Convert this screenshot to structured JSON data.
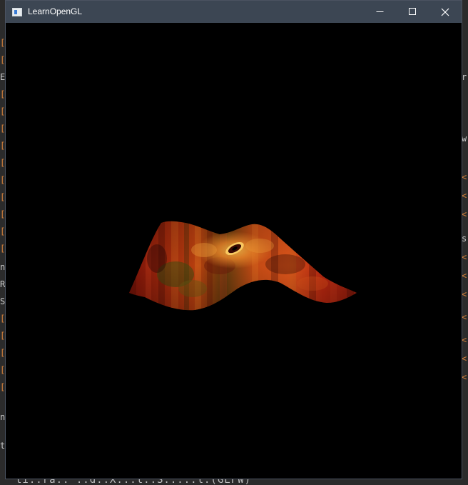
{
  "window": {
    "title": "LearnOpenGL",
    "icons": {
      "app": "app-window-icon",
      "minimize": "minimize-icon",
      "maximize": "maximize-icon",
      "close": "close-icon"
    }
  },
  "viewport": {
    "background": "#000000",
    "content": "textured-wavy-plane",
    "texture_colors": [
      "#7a1208",
      "#b3260f",
      "#d9531a",
      "#f08a2a",
      "#5a4a10",
      "#200503"
    ]
  },
  "background_editor": {
    "bottom_text": "ti..ra.. ..d..X...t..S.....l.(GLFW)"
  }
}
